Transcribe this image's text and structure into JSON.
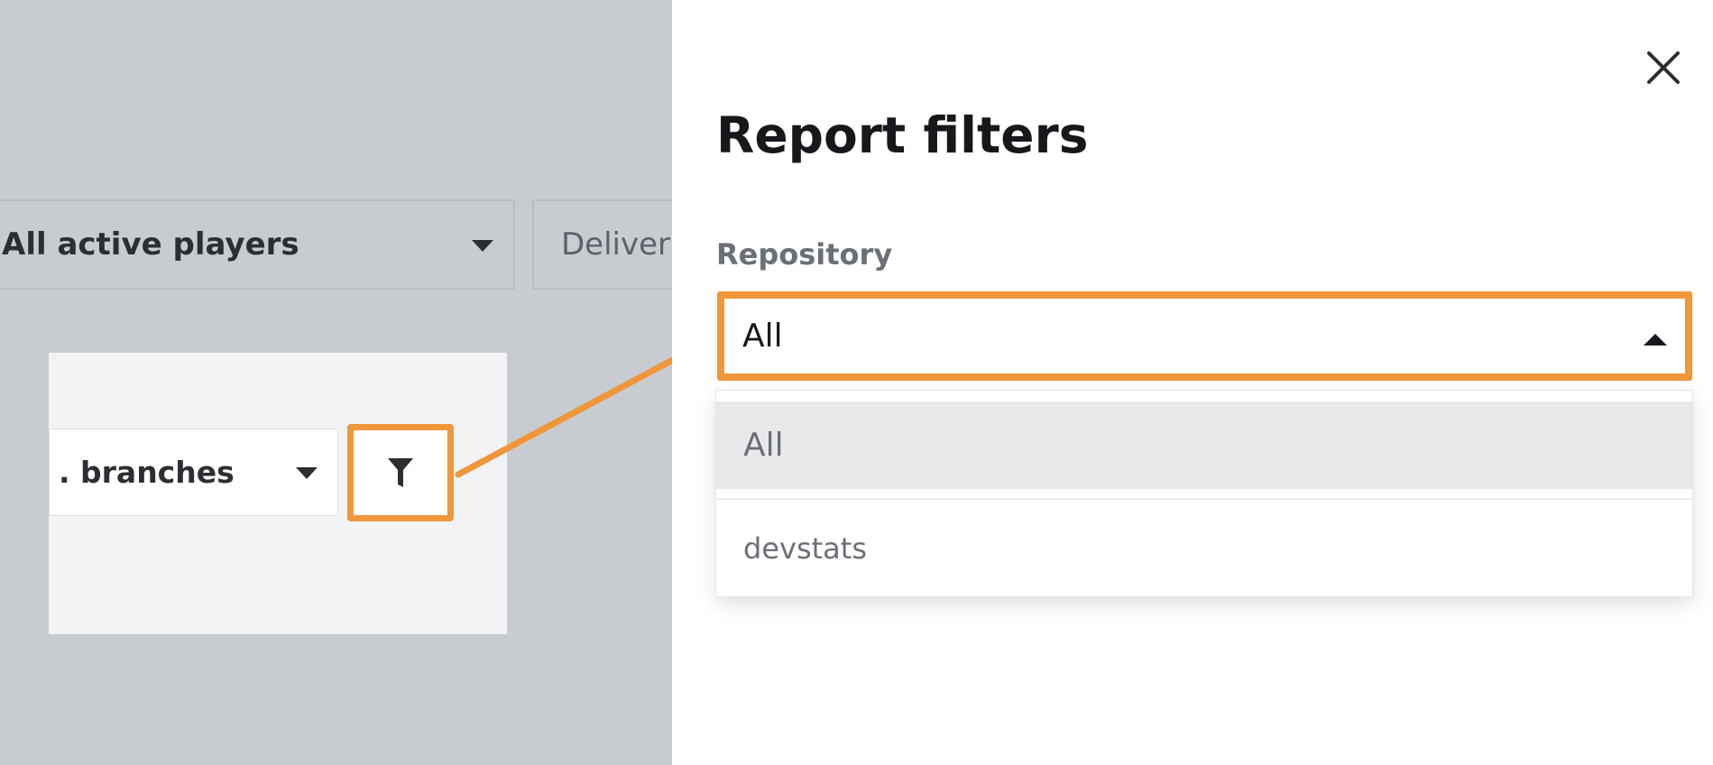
{
  "background": {
    "players_select": {
      "label": "All active players",
      "icon": "chevron-down-icon"
    },
    "deliver_select": {
      "label": "Deliver"
    },
    "branches_select": {
      "label": "All branches",
      "visible_label": ". branches",
      "icon": "chevron-down-icon"
    },
    "filter_button": {
      "icon": "filter-icon"
    }
  },
  "drawer": {
    "title": "Report filters",
    "close_icon": "close-icon",
    "repository": {
      "label": "Repository",
      "selected_value": "All",
      "state": "open",
      "options": [
        "All",
        "devstats"
      ],
      "highlighted_option": "All"
    }
  },
  "colors": {
    "highlight": "#f0963b",
    "overlay": "#c8ccd1",
    "drawer_bg": "#ffffff",
    "text_dark": "#16181c",
    "text_muted": "#6b6f76"
  }
}
